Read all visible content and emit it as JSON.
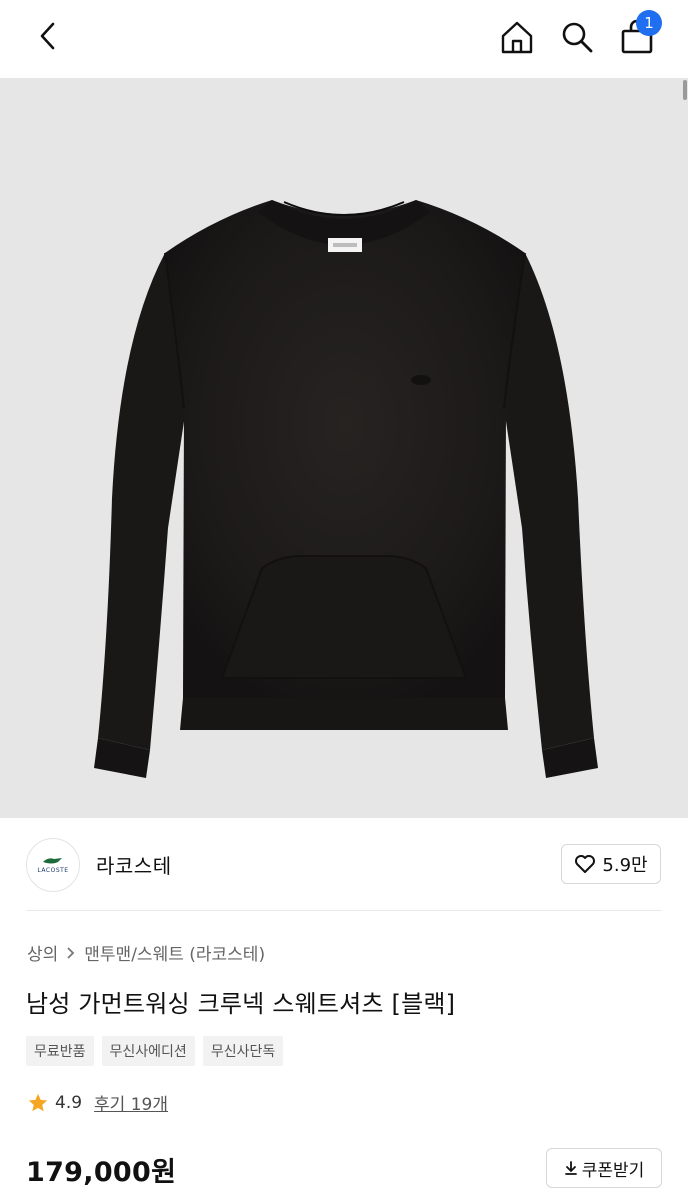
{
  "header": {
    "back_icon": "chevron-left-icon",
    "home_icon": "home-icon",
    "search_icon": "search-icon",
    "cart_icon": "shopping-bag-icon",
    "cart_count": "1"
  },
  "product_image": {
    "description_icon": "sweatshirt-image",
    "logo_text": "LACOSTE"
  },
  "brand": {
    "logo_text": "LACOSTE",
    "name": "라코스테",
    "like_icon": "heart-outline-icon",
    "like_count": "5.9만"
  },
  "breadcrumb": {
    "level1": "상의",
    "separator_icon": "chevron-right-icon",
    "level2": "맨투맨/스웨트 (라코스테)"
  },
  "product": {
    "title": "남성 가먼트워싱 크루넥 스웨트셔츠 [블랙]",
    "tags": [
      "무료반품",
      "무신사에디션",
      "무신사단독"
    ],
    "rating_icon": "star-icon",
    "rating": "4.9",
    "review_text": "후기 19개",
    "price": "179,000원",
    "coupon_icon": "download-icon",
    "coupon_label": "쿠폰받기"
  },
  "colors": {
    "accent": "#1f6ff0",
    "star": "#f5a623",
    "hero_bg": "#e6e6e7",
    "garment": "#1b1918"
  }
}
